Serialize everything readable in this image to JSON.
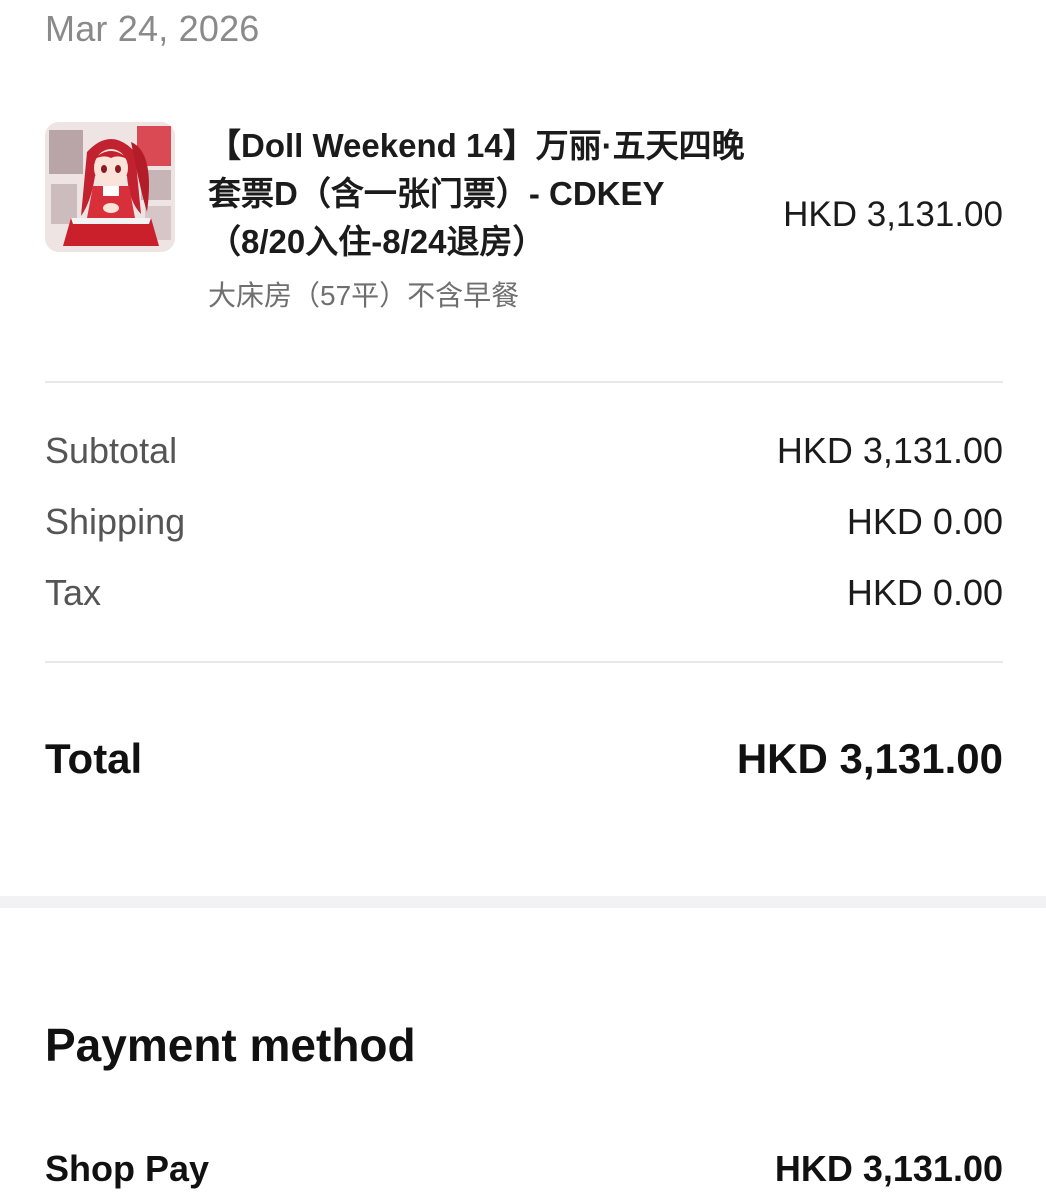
{
  "order": {
    "date": "Mar 24, 2026"
  },
  "item": {
    "thumbnail": "product-thumbnail-anime-girl-red-dress",
    "title": "【Doll Weekend 14】万丽·五天四晚套票D（含一张门票）- CDKEY （8/20入住-8/24退房）",
    "variant": "大床房（57平）不含早餐",
    "price": "HKD 3,131.00"
  },
  "summary": {
    "subtotal_label": "Subtotal",
    "subtotal_value": "HKD 3,131.00",
    "shipping_label": "Shipping",
    "shipping_value": "HKD 0.00",
    "tax_label": "Tax",
    "tax_value": "HKD 0.00"
  },
  "total": {
    "label": "Total",
    "value": "HKD 3,131.00"
  },
  "payment": {
    "heading": "Payment method",
    "method_label": "Shop Pay",
    "method_amount": "HKD 3,131.00"
  },
  "colors": {
    "accent_red": "#d8303a",
    "muted_text": "#8a8a8a",
    "divider": "#e9e9e9"
  }
}
